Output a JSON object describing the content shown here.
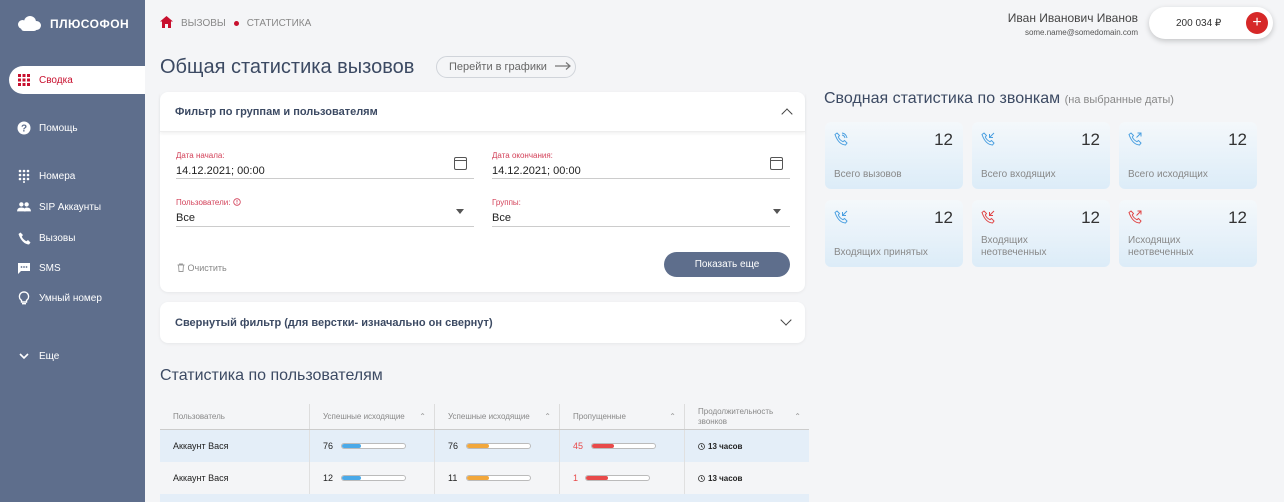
{
  "brand": {
    "name": "ПЛЮСОФОН"
  },
  "sidebar": {
    "items": [
      {
        "label": "Сводка",
        "icon": "grid-icon"
      },
      {
        "label": "Помощь",
        "icon": "help-icon"
      },
      {
        "label": "Номера",
        "icon": "dialpad-icon"
      },
      {
        "label": "SIP Аккаунты",
        "icon": "users-icon"
      },
      {
        "label": "Вызовы",
        "icon": "phone-icon"
      },
      {
        "label": "SMS",
        "icon": "sms-icon"
      },
      {
        "label": "Умный номер",
        "icon": "bulb-icon"
      },
      {
        "label": "Еще",
        "icon": "chevron-down-icon"
      }
    ]
  },
  "breadcrumb": {
    "items": [
      "ВЫЗОВЫ",
      "СТАТИСТИКА"
    ]
  },
  "user": {
    "name": "Иван Иванович Иванов",
    "email": "some.name@somedomain.com"
  },
  "balance": {
    "value": "200 034 ₽"
  },
  "page": {
    "title": "Общая статистика вызовов",
    "charts_link": "Перейти в графики"
  },
  "filter": {
    "title": "Фильтр по группам и пользователям",
    "start_label": "Дата начала:",
    "start_value": "14.12.2021; 00:00",
    "end_label": "Дата окончания:",
    "end_value": "14.12.2021; 00:00",
    "users_label": "Пользователи:",
    "users_value": "Все",
    "groups_label": "Группы:",
    "groups_value": "Все",
    "clear_label": "Очистить",
    "show_more_label": "Показать еще"
  },
  "collapsed_filter": {
    "title": "Свернутый фильтр (для верстки- изначально он свернут)"
  },
  "users_stats": {
    "title": "Статистика по пользователям",
    "columns": [
      "Пользователь",
      "Успешные исходящие",
      "Успешные исходящие",
      "Пропущенные",
      "Продолжительность звонков"
    ],
    "rows": [
      {
        "user": "Аккаунт Вася",
        "out1": "76",
        "out1_pct": 0.3,
        "out2": "76",
        "out2_pct": 0.35,
        "missed": "45",
        "missed_pct": 0.35,
        "duration": "13 часов"
      },
      {
        "user": "Аккаунт Вася",
        "out1": "12",
        "out1_pct": 0.3,
        "out2": "11",
        "out2_pct": 0.35,
        "missed": "1",
        "missed_pct": 0.35,
        "duration": "13 часов"
      }
    ]
  },
  "summary": {
    "title": "Сводная статистика по звонкам",
    "subtitle": "(на выбранные даты)",
    "cards": [
      {
        "value": "12",
        "label": "Всего вызовов",
        "icon": "phone-call-icon",
        "color": "#4a9fe0"
      },
      {
        "value": "12",
        "label": "Всего входящих",
        "icon": "phone-incoming-icon",
        "color": "#4a9fe0"
      },
      {
        "value": "12",
        "label": "Всего исходящих",
        "icon": "phone-outgoing-icon",
        "color": "#4a9fe0"
      },
      {
        "value": "12",
        "label": "Входящих принятых",
        "icon": "phone-incoming-icon",
        "color": "#4a9fe0"
      },
      {
        "value": "12",
        "label": "Входящих неотвеченных",
        "icon": "phone-missed-in-icon",
        "color": "#e04545"
      },
      {
        "value": "12",
        "label": "Исходящих неотвеченных",
        "icon": "phone-missed-out-icon",
        "color": "#e04545"
      }
    ]
  },
  "colors": {
    "sidebar": "#5e6e8c",
    "accent": "#c8102e",
    "bar_blue": "#4aa9e8",
    "bar_orange": "#f2a73b",
    "bar_red": "#e84a4a"
  }
}
